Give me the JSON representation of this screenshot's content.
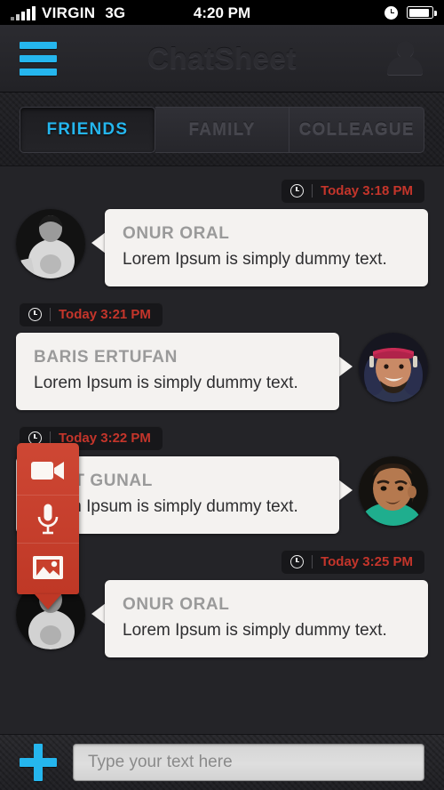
{
  "status_bar": {
    "signal_icon": "signal-bars-icon",
    "carrier": "VIRGIN",
    "network": "3G",
    "time": "4:20 PM",
    "clock_icon": "clock-icon",
    "battery_icon": "battery-icon"
  },
  "header": {
    "menu_icon": "hamburger-menu-icon",
    "title": "ChatSheet",
    "profile_icon": "user-avatar-icon",
    "accent_color": "#25b6ee"
  },
  "tabs": {
    "items": [
      {
        "label": "FRIENDS",
        "active": true
      },
      {
        "label": "FAMILY",
        "active": false
      },
      {
        "label": "COLLEAGUE",
        "active": false
      }
    ]
  },
  "chat": {
    "timestamp_color": "#c4352b",
    "messages": [
      {
        "side": "left",
        "timestamp": "Today 3:18 PM",
        "clock_icon": "clock-icon",
        "name": "ONUR ORAL",
        "text": "Lorem Ipsum is simply dummy text.",
        "avatar": "avatar-onur-oral"
      },
      {
        "side": "right",
        "timestamp": "Today 3:21 PM",
        "clock_icon": "clock-icon",
        "name": "BARIS ERTUFAN",
        "text": "Lorem Ipsum is simply dummy text.",
        "avatar": "avatar-baris-ertufan"
      },
      {
        "side": "right",
        "timestamp": "Today 3:22 PM",
        "clock_icon": "clock-icon",
        "name": "FIRAT GUNAL",
        "text": "Lorem Ipsum is simply dummy text.",
        "avatar": "avatar-firat-gunal"
      },
      {
        "side": "left",
        "timestamp": "Today 3:25 PM",
        "clock_icon": "clock-icon",
        "name": "ONUR ORAL",
        "text": "Lorem Ipsum is simply dummy text.",
        "avatar": "avatar-onur-oral-2"
      }
    ]
  },
  "action_panel": {
    "background_color": "#c8402c",
    "items": [
      {
        "icon": "video-camera-icon"
      },
      {
        "icon": "microphone-icon"
      },
      {
        "icon": "photo-image-icon"
      }
    ]
  },
  "bottom_bar": {
    "add_icon": "plus-icon",
    "input_placeholder": "Type your text here",
    "input_value": ""
  }
}
